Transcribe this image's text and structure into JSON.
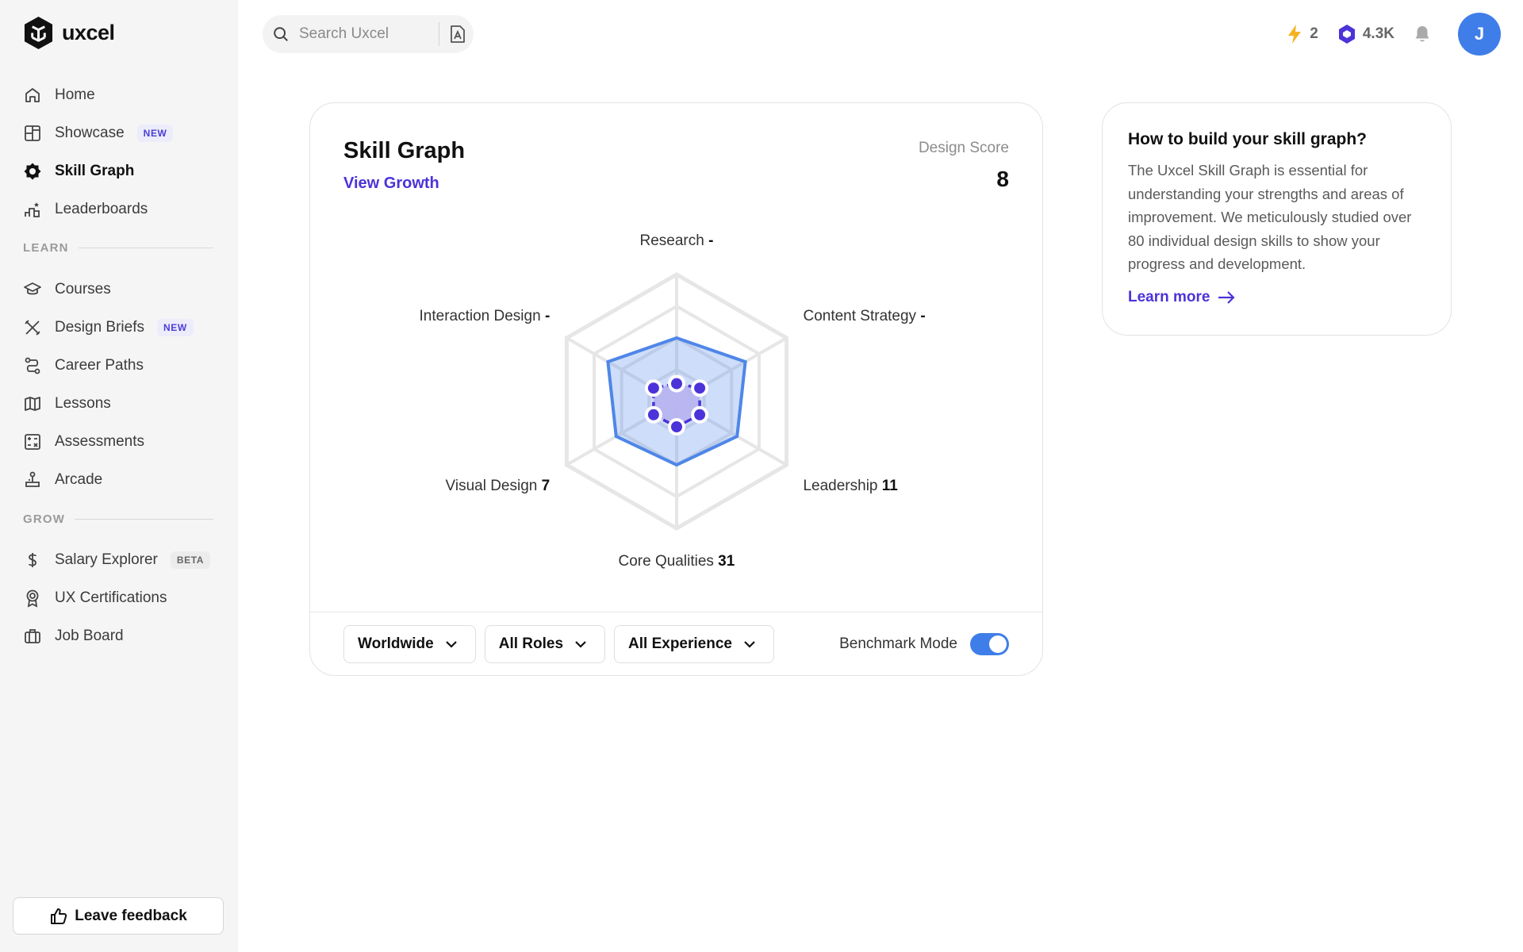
{
  "app": {
    "name": "uxcel"
  },
  "sidebar": {
    "items": [
      {
        "label": "Home",
        "icon": "home-icon"
      },
      {
        "label": "Showcase",
        "icon": "showcase-icon",
        "badge": "NEW"
      },
      {
        "label": "Skill Graph",
        "icon": "skill-graph-icon",
        "active": true
      },
      {
        "label": "Leaderboards",
        "icon": "leaderboard-icon"
      }
    ],
    "learn_label": "LEARN",
    "learn_items": [
      {
        "label": "Courses",
        "icon": "graduation-cap-icon"
      },
      {
        "label": "Design Briefs",
        "icon": "design-briefs-icon",
        "badge": "NEW"
      },
      {
        "label": "Career Paths",
        "icon": "career-paths-icon"
      },
      {
        "label": "Lessons",
        "icon": "map-icon"
      },
      {
        "label": "Assessments",
        "icon": "assessment-icon"
      },
      {
        "label": "Arcade",
        "icon": "joystick-icon"
      }
    ],
    "grow_label": "GROW",
    "grow_items": [
      {
        "label": "Salary Explorer",
        "icon": "dollar-icon",
        "badge": "BETA"
      },
      {
        "label": "UX Certifications",
        "icon": "certificate-icon"
      },
      {
        "label": "Job Board",
        "icon": "briefcase-icon"
      }
    ],
    "feedback_label": "Leave feedback"
  },
  "topbar": {
    "search_placeholder": "Search Uxcel",
    "streak": "2",
    "xp": "4.3K",
    "avatar_initial": "J",
    "colors": {
      "streak": "#f5b323",
      "xp": "#4b33d9",
      "avatar": "#3f7ee8"
    }
  },
  "skill_card": {
    "title": "Skill Graph",
    "view_growth": "View Growth",
    "score_label": "Design Score",
    "score_value": "8",
    "axes": [
      {
        "name": "Research",
        "value": "-"
      },
      {
        "name": "Content Strategy",
        "value": "-"
      },
      {
        "name": "Leadership",
        "value": "11"
      },
      {
        "name": "Core Qualities",
        "value": "31"
      },
      {
        "name": "Visual Design",
        "value": "7"
      },
      {
        "name": "Interaction Design",
        "value": "-"
      }
    ],
    "filters": [
      "Worldwide",
      "All Roles",
      "All Experience"
    ],
    "benchmark_label": "Benchmark Mode",
    "benchmark_on": true
  },
  "chart_data": {
    "type": "radar",
    "categories": [
      "Research",
      "Content Strategy",
      "Leadership",
      "Core Qualities",
      "Visual Design",
      "Interaction Design"
    ],
    "rings": 4,
    "series": [
      {
        "values": [
          0.5,
          0.625,
          0.55,
          0.5,
          0.55,
          0.625
        ],
        "color": "#4f86e8"
      },
      {
        "values": [
          0.14,
          0.21,
          0.21,
          0.2,
          0.21,
          0.21
        ],
        "color": "#4b33d9"
      }
    ]
  },
  "info_card": {
    "title": "How to build your skill graph?",
    "body": "The Uxcel Skill Graph is essential for understanding your strengths and areas of improvement. We meticulously studied over 80 individual design skills to show your progress and development.",
    "learn_more": "Learn more"
  }
}
